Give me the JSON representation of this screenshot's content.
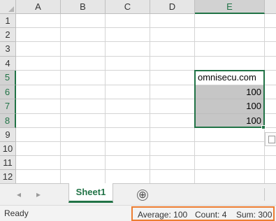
{
  "columns": [
    "A",
    "B",
    "C",
    "D",
    "E"
  ],
  "rows": [
    "1",
    "2",
    "3",
    "4",
    "5",
    "6",
    "7",
    "8",
    "9",
    "10",
    "11",
    "12"
  ],
  "cells": {
    "E5": "omnisecu.com",
    "E6": "100",
    "E7": "100",
    "E8": "100"
  },
  "sheet_tab": "Sheet1",
  "add_sheet_symbol": "⊕",
  "nav_prev": "◂",
  "nav_next": "▸",
  "status": {
    "ready": "Ready",
    "average": "Average: 100",
    "count": "Count: 4",
    "sum": "Sum: 300"
  },
  "colors": {
    "accent": "#217346",
    "highlight_box": "#ed7d31",
    "selected_fill": "#c6c6c6"
  }
}
